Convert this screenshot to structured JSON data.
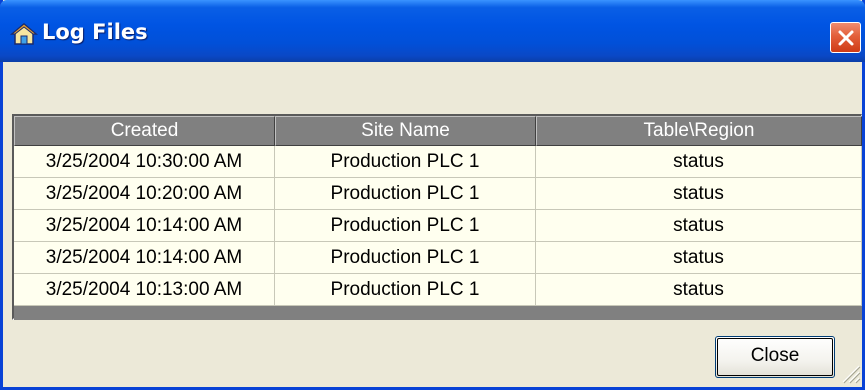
{
  "window": {
    "title": "Log Files",
    "icon": "house-icon"
  },
  "grid": {
    "columns": [
      "Created",
      "Site Name",
      "Table\\Region"
    ],
    "rows": [
      [
        "3/25/2004 10:30:00 AM",
        "Production PLC 1",
        "status"
      ],
      [
        "3/25/2004 10:20:00 AM",
        "Production PLC 1",
        "status"
      ],
      [
        "3/25/2004 10:14:00 AM",
        "Production PLC 1",
        "status"
      ],
      [
        "3/25/2004 10:14:00 AM",
        "Production PLC 1",
        "status"
      ],
      [
        "3/25/2004 10:13:00 AM",
        "Production PLC 1",
        "status"
      ]
    ]
  },
  "buttons": {
    "close_label": "Close"
  },
  "colors": {
    "titlebar": "#0054e3",
    "window_bg": "#ece9d8",
    "row_bg": "#ffffef",
    "header_bg": "#808080"
  }
}
